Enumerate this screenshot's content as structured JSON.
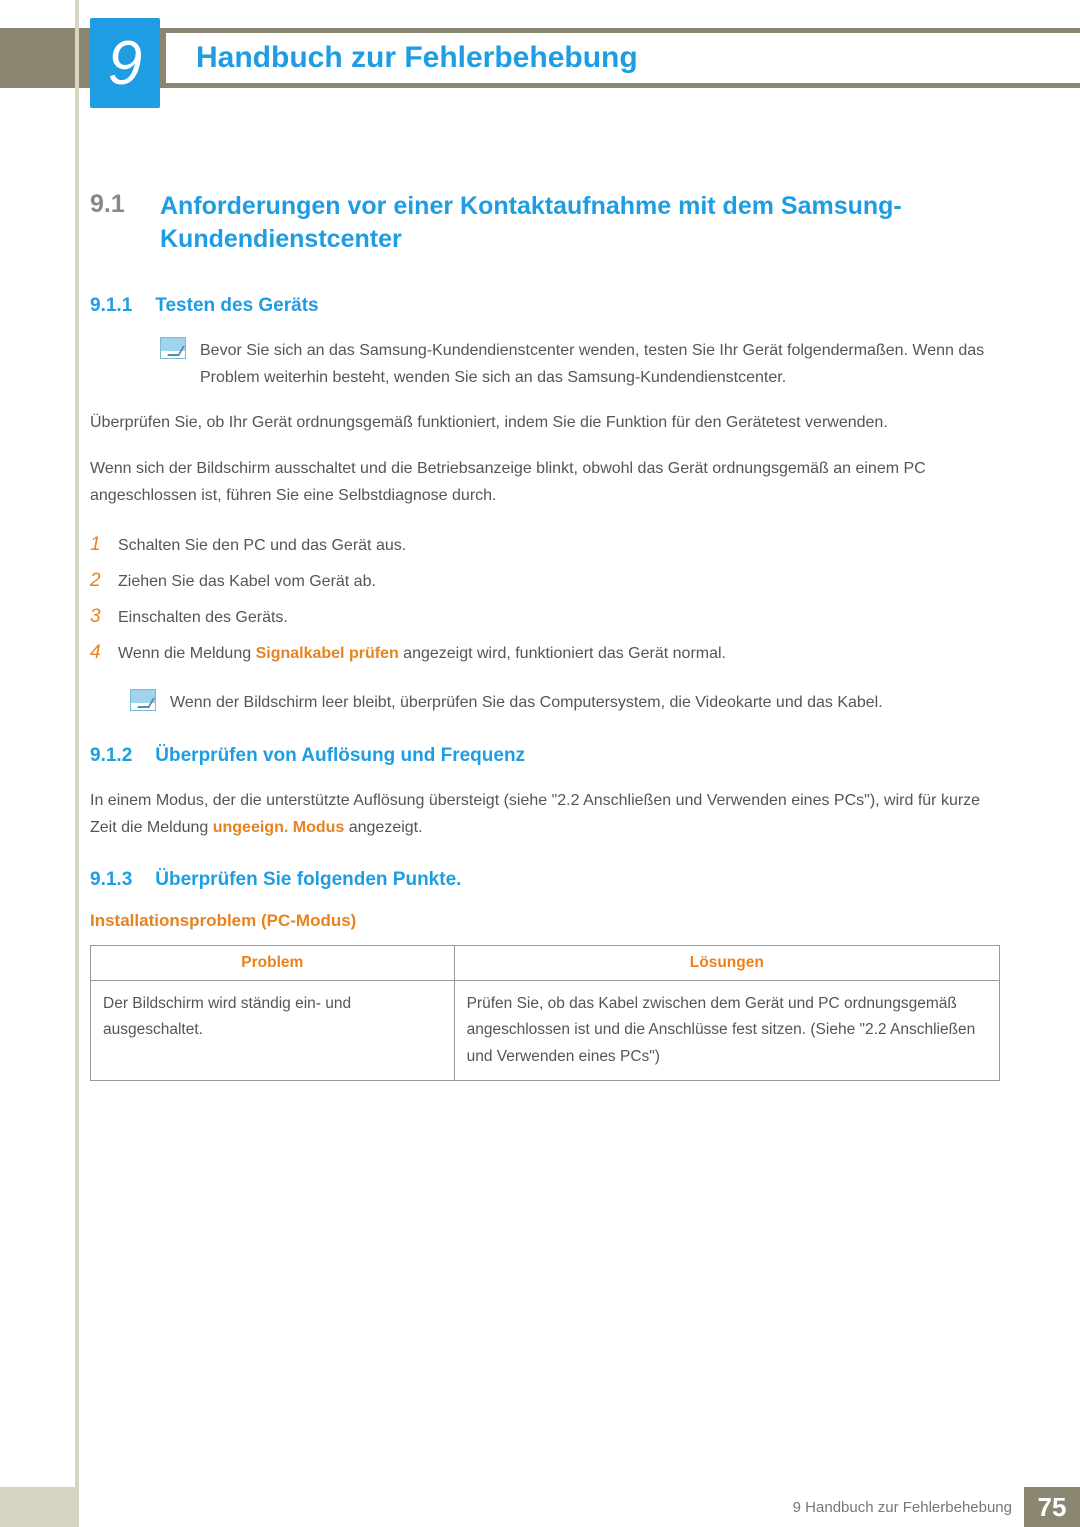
{
  "chapter": {
    "number": "9",
    "title": "Handbuch zur Fehlerbehebung"
  },
  "section": {
    "number": "9.1",
    "title": "Anforderungen vor einer Kontaktaufnahme mit dem Samsung-Kundendienstcenter"
  },
  "sub1": {
    "number": "9.1.1",
    "title": "Testen des Geräts",
    "note": "Bevor Sie sich an das Samsung-Kundendienstcenter wenden, testen Sie Ihr Gerät folgendermaßen. Wenn das Problem weiterhin besteht, wenden Sie sich an das Samsung-Kundendienstcenter.",
    "p1": "Überprüfen Sie, ob Ihr Gerät ordnungsgemäß funktioniert, indem Sie die Funktion für den Gerätetest verwenden.",
    "p2": "Wenn sich der Bildschirm ausschaltet und die Betriebsanzeige blinkt, obwohl das Gerät ordnungsgemäß an einem PC angeschlossen ist, führen Sie eine Selbstdiagnose durch.",
    "steps": [
      {
        "n": "1",
        "text": "Schalten Sie den PC und das Gerät aus."
      },
      {
        "n": "2",
        "text": "Ziehen Sie das Kabel vom Gerät ab."
      },
      {
        "n": "3",
        "text": "Einschalten des Geräts."
      },
      {
        "n": "4",
        "pre": "Wenn die Meldung ",
        "hl": "Signalkabel prüfen",
        "post": " angezeigt wird, funktioniert das Gerät normal."
      }
    ],
    "note2": "Wenn der Bildschirm leer bleibt, überprüfen Sie das Computersystem, die Videokarte und das Kabel."
  },
  "sub2": {
    "number": "9.1.2",
    "title": "Überprüfen von Auflösung und Frequenz",
    "p_pre": "In einem Modus, der die unterstützte Auflösung übersteigt (siehe \"2.2 Anschließen und Verwenden eines PCs\"), wird für kurze Zeit die Meldung ",
    "p_hl": "ungeeign. Modus",
    "p_post": " angezeigt."
  },
  "sub3": {
    "number": "9.1.3",
    "title": "Überprüfen Sie folgenden Punkte.",
    "group_title": "Installationsproblem (PC-Modus)",
    "table": {
      "headers": [
        "Problem",
        "Lösungen"
      ],
      "rows": [
        {
          "problem": "Der Bildschirm wird ständig ein- und ausgeschaltet.",
          "solution": "Prüfen Sie, ob das Kabel zwischen dem Gerät und PC ordnungsgemäß angeschlossen ist und die Anschlüsse fest sitzen. (Siehe \"2.2 Anschließen und Verwenden eines PCs\")"
        }
      ]
    }
  },
  "footer": {
    "text": "9 Handbuch zur Fehlerbehebung",
    "page": "75"
  }
}
